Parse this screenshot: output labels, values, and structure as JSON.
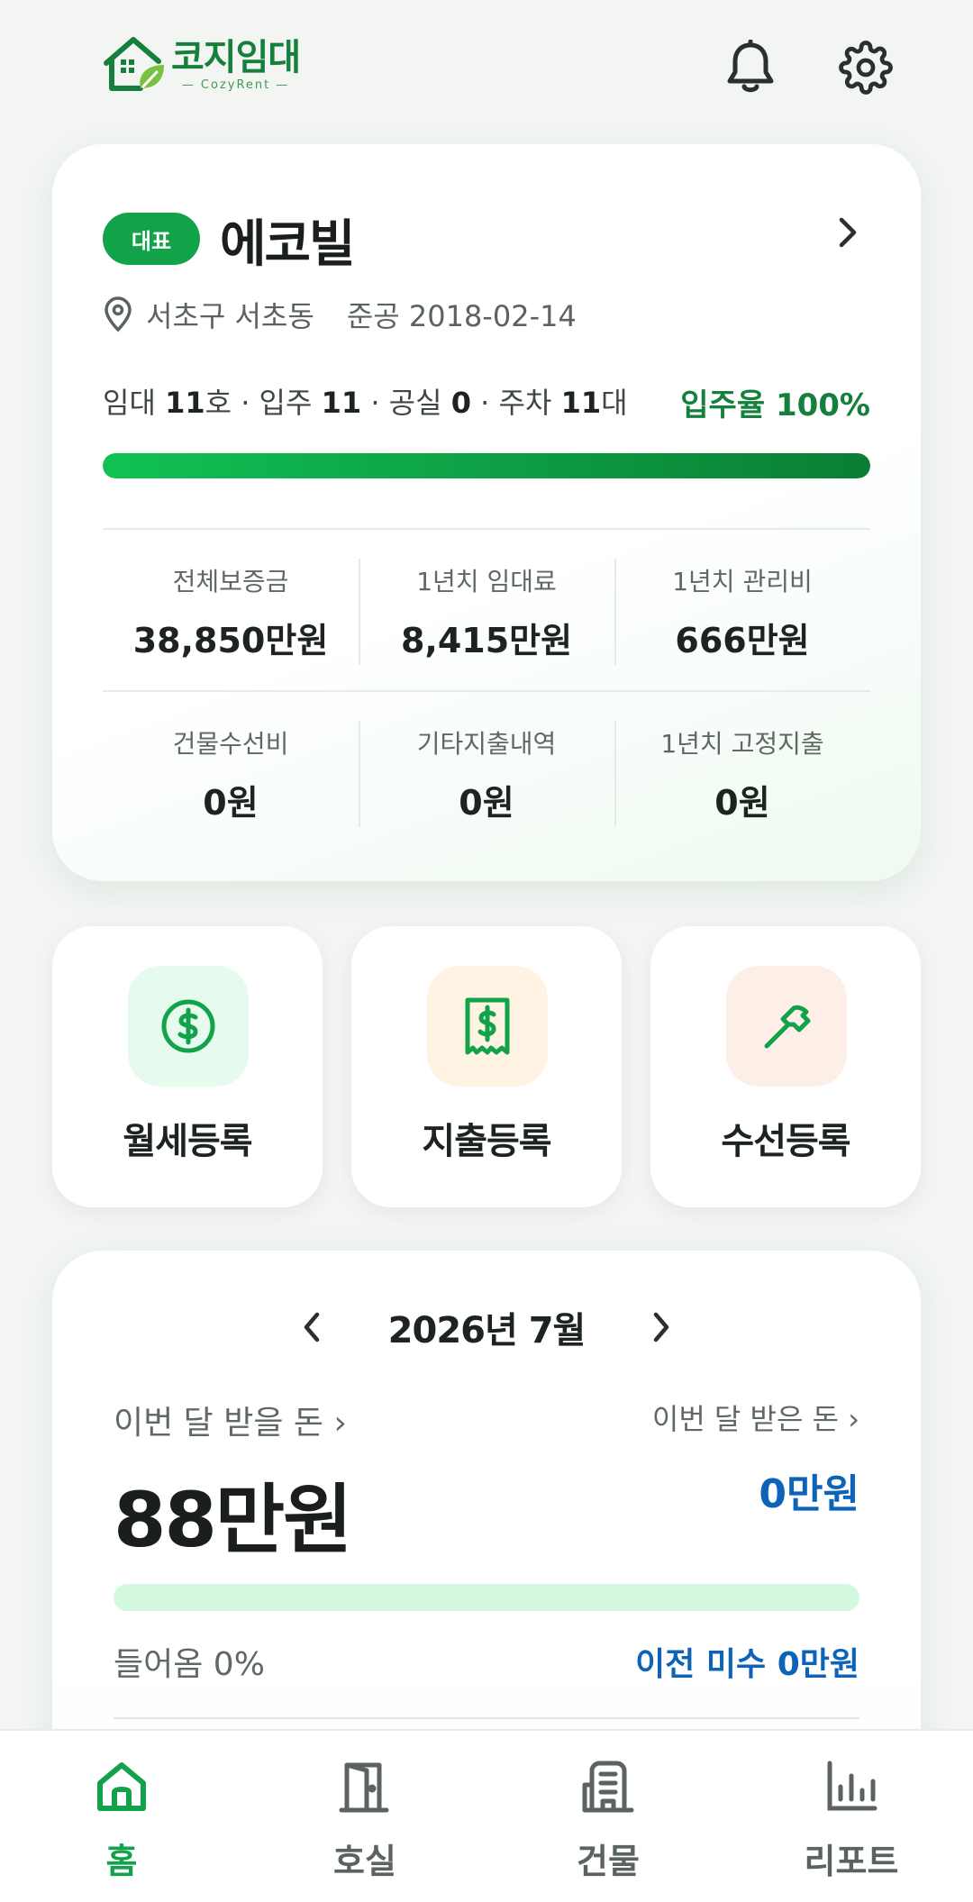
{
  "app": {
    "logo_title": "코지임대",
    "logo_sub": "— CozyRent —"
  },
  "building": {
    "badge": "대표",
    "name": "에코빌",
    "address": "서초구 서초동",
    "built": "준공 2018-02-14",
    "stats": {
      "rent_prefix": "임대 ",
      "rent_count": "11",
      "rent_suffix": "호 · 입주 ",
      "occupied": "11",
      "vacant_prefix": " · 공실 ",
      "vacant": "0",
      "parking_prefix": " · 주차 ",
      "parking": "11",
      "parking_suffix": "대"
    },
    "occupancy_label": "입주율 100%",
    "occupancy_fraction": 1.0,
    "metrics_row1": [
      {
        "label": "전체보증금",
        "value": "38,850만원"
      },
      {
        "label": "1년치 임대료",
        "value": "8,415만원"
      },
      {
        "label": "1년치 관리비",
        "value": "666만원"
      }
    ],
    "metrics_row2": [
      {
        "label": "건물수선비",
        "value": "0원"
      },
      {
        "label": "기타지출내역",
        "value": "0원"
      },
      {
        "label": "1년치 고정지출",
        "value": "0원"
      }
    ]
  },
  "actions": [
    {
      "label": "월세등록",
      "icon": "dollar-circle-icon"
    },
    {
      "label": "지출등록",
      "icon": "receipt-dollar-icon"
    },
    {
      "label": "수선등록",
      "icon": "hammer-icon"
    }
  ],
  "monthly": {
    "title": "2026년 7월",
    "due_label": "이번 달 받을 돈 ›",
    "received_label": "이번 달 받은 돈 ›",
    "due_amount": "88만원",
    "received_amount": "0만원",
    "received_fraction": 0.0,
    "in_percent": "들어옴 0%",
    "prev_unpaid": "이전 미수 0만원"
  },
  "nav": [
    {
      "label": "홈",
      "icon": "home-icon",
      "active": true
    },
    {
      "label": "호실",
      "icon": "door-icon",
      "active": false
    },
    {
      "label": "건물",
      "icon": "building-icon",
      "active": false
    },
    {
      "label": "리포트",
      "icon": "bar-chart-icon",
      "active": false
    }
  ],
  "colors": {
    "brand_green": "#12a24a",
    "dark_green": "#15803d",
    "blue": "#0c63b8"
  }
}
